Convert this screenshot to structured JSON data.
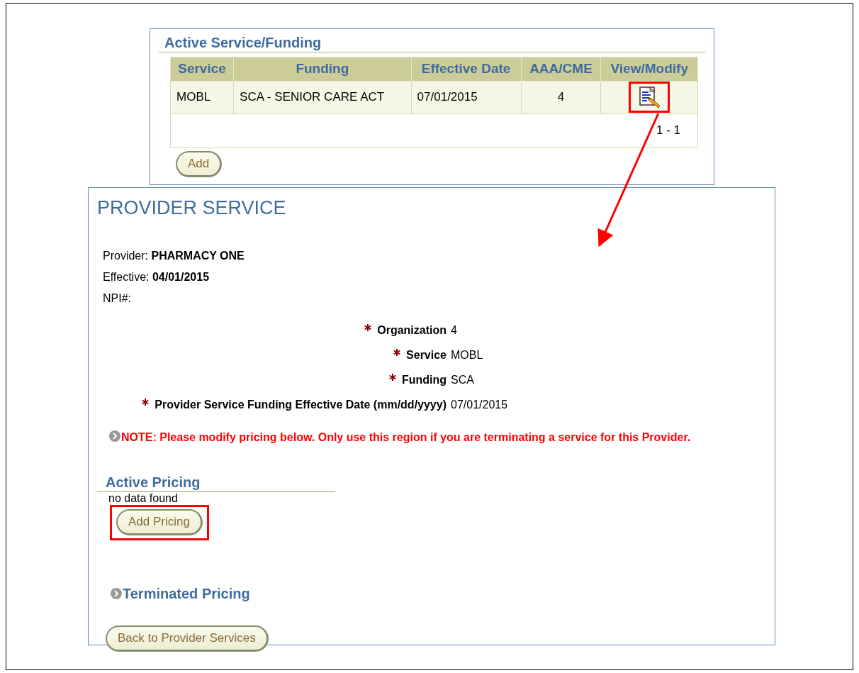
{
  "active_service_funding": {
    "title": "Active Service/Funding",
    "columns": [
      "Service",
      "Funding",
      "Effective Date",
      "AAA/CME",
      "View/Modify"
    ],
    "rows": [
      {
        "service": "MOBL",
        "funding": "SCA - SENIOR CARE ACT",
        "effective_date": "07/01/2015",
        "aaa_cme": "4",
        "view_modify_highlighted": true
      }
    ],
    "pagination": "1 - 1",
    "add_button": "Add"
  },
  "provider_service": {
    "title": "PROVIDER SERVICE",
    "info": [
      {
        "label": "Provider:",
        "value": "PHARMACY ONE"
      },
      {
        "label": "Effective:",
        "value": "04/01/2015"
      },
      {
        "label": "NPI#:"
      }
    ],
    "fields": [
      {
        "label": "Organization",
        "value": "4",
        "required": true
      },
      {
        "label": "Service",
        "value": "MOBL",
        "required": true
      },
      {
        "label": "Funding",
        "value": "SCA",
        "required": true
      },
      {
        "label": "Provider Service Funding Effective Date (mm/dd/yyyy)",
        "value": "07/01/2015",
        "required": true
      }
    ],
    "note": "NOTE: Please modify pricing below. Only use this region if you are terminating a service for this Provider.",
    "active_pricing": {
      "title": "Active Pricing",
      "empty_text": "no data found",
      "button": {
        "label": "Add Pricing",
        "highlighted": true
      }
    },
    "terminated_pricing": {
      "title": "Terminated Pricing",
      "expanded": false
    },
    "back_button": "Back to Provider Services"
  }
}
